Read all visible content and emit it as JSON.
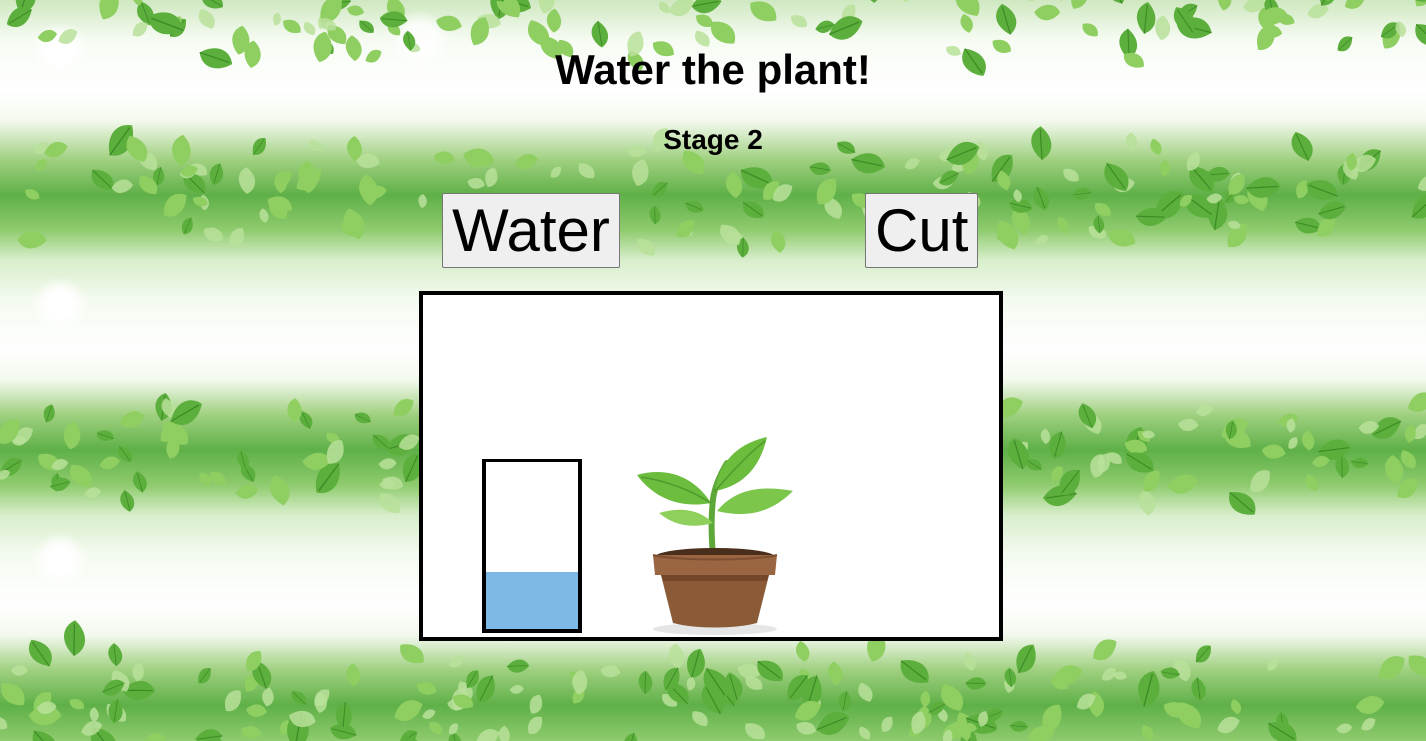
{
  "page": {
    "title": "Water the plant!",
    "stage_label": "Stage 2"
  },
  "controls": {
    "water_label": "Water",
    "cut_label": "Cut"
  },
  "game": {
    "water_level": 0.34,
    "water_color": "#7eb9e6",
    "plant": "potted-sprout",
    "pot_color": "#8b5a36",
    "leaf_color": "#6cbd3e"
  }
}
